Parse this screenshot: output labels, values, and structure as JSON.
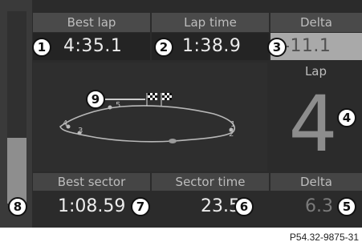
{
  "top": {
    "best_lap_label": "Best lap",
    "best_lap_value": "4:35.1",
    "lap_time_label": "Lap time",
    "lap_time_value": "1:38.9",
    "delta_label": "Delta",
    "delta_value": "-11.1"
  },
  "lap": {
    "label": "Lap",
    "value": "4"
  },
  "bottom": {
    "best_sector_label": "Best sector",
    "best_sector_value": "1:08.59",
    "sector_time_label": "Sector time",
    "sector_time_value": "23.5",
    "delta_label": "Delta",
    "delta_value": "6.3"
  },
  "track": {
    "sector_markers": [
      "1",
      "2",
      "3",
      "4",
      "5"
    ]
  },
  "sidebar": {
    "level": 0.34
  },
  "callouts": [
    "1",
    "2",
    "3",
    "4",
    "5",
    "6",
    "7",
    "8",
    "9"
  ],
  "caption": "P54.32-9875-31",
  "colors": {
    "screen": "#2b2b2b",
    "header": "#4a4a4a",
    "delta_highlight": "#a9a9a9",
    "track_line": "#b8b8b8"
  },
  "icons": {
    "finish_flag": "checkered-flag-icon"
  }
}
